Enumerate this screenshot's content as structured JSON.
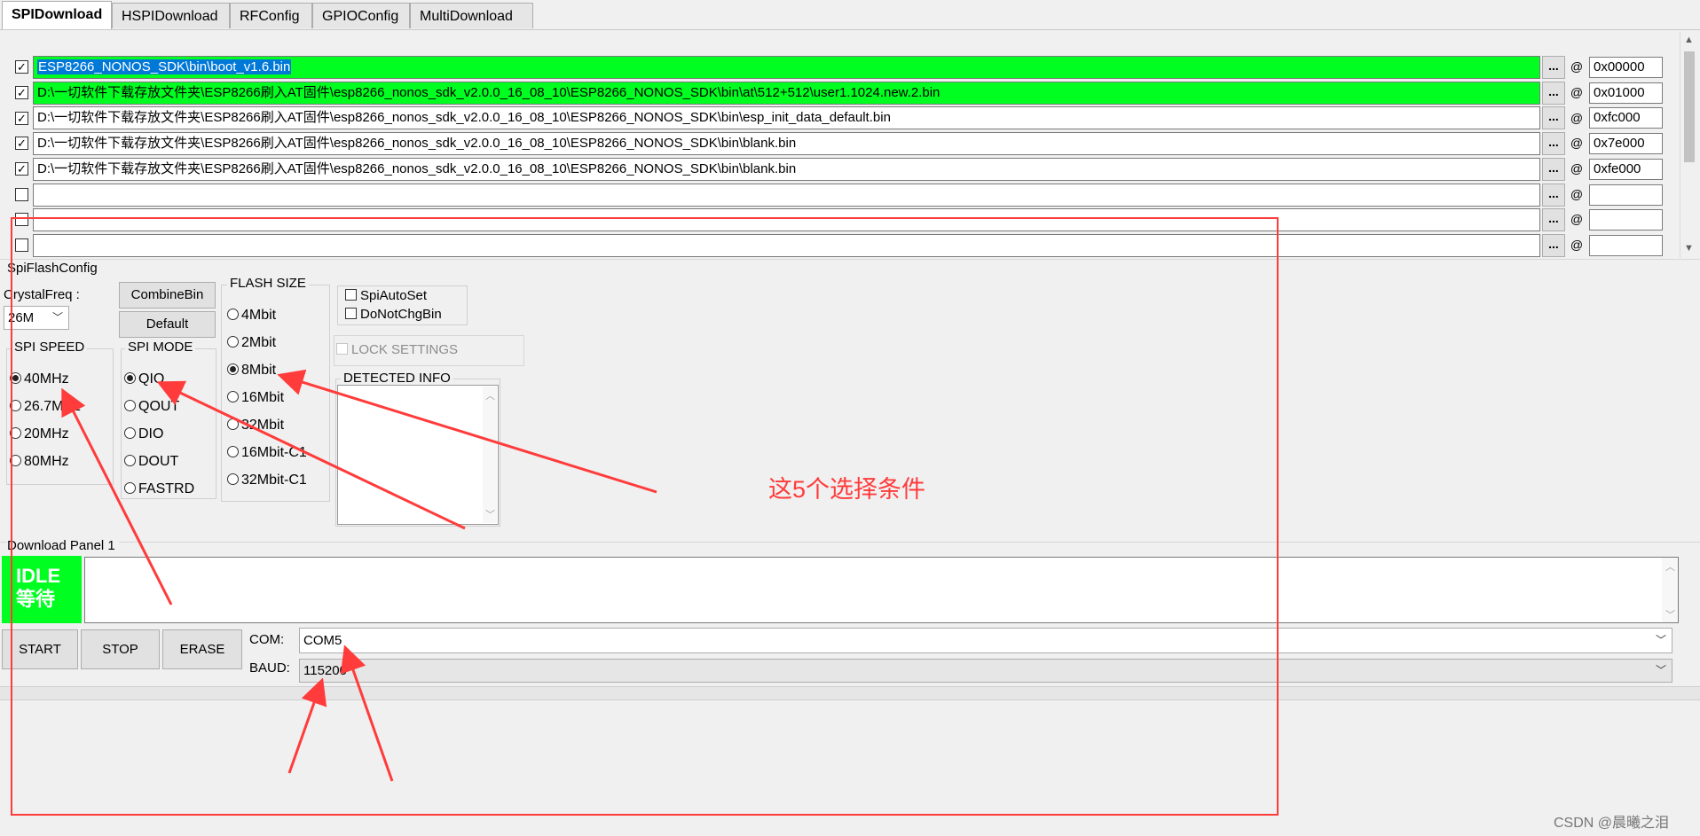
{
  "tabs": [
    "SPIDownload",
    "HSPIDownload",
    "RFConfig",
    "GPIOConfig",
    "MultiDownload"
  ],
  "files": [
    {
      "checked": true,
      "path": "ESP8266_NONOS_SDK\\bin\\boot_v1.6.bin",
      "address": "0x00000",
      "status_color": "#00ff21"
    },
    {
      "checked": true,
      "path": "D:\\一切软件下载存放文件夹\\ESP8266刷入AT固件\\esp8266_nonos_sdk_v2.0.0_16_08_10\\ESP8266_NONOS_SDK\\bin\\at\\512+512\\user1.1024.new.2.bin",
      "address": "0x01000",
      "status_color": "#00ff21"
    },
    {
      "checked": true,
      "path": "D:\\一切软件下载存放文件夹\\ESP8266刷入AT固件\\esp8266_nonos_sdk_v2.0.0_16_08_10\\ESP8266_NONOS_SDK\\bin\\esp_init_data_default.bin",
      "address": "0xfc000"
    },
    {
      "checked": true,
      "path": "D:\\一切软件下载存放文件夹\\ESP8266刷入AT固件\\esp8266_nonos_sdk_v2.0.0_16_08_10\\ESP8266_NONOS_SDK\\bin\\blank.bin",
      "address": "0x7e000"
    },
    {
      "checked": true,
      "path": "D:\\一切软件下载存放文件夹\\ESP8266刷入AT固件\\esp8266_nonos_sdk_v2.0.0_16_08_10\\ESP8266_NONOS_SDK\\bin\\blank.bin",
      "address": "0xfe000"
    },
    {
      "checked": false,
      "path": "",
      "address": ""
    },
    {
      "checked": false,
      "path": "",
      "address": ""
    },
    {
      "checked": false,
      "path": "",
      "address": ""
    }
  ],
  "browse_label": "...",
  "at_label": "@",
  "spi_flash_config": {
    "title": "SpiFlashConfig",
    "crystal_label": "CrystalFreq :",
    "crystal_value": "26M",
    "combine_button": "CombineBin",
    "default_button": "Default",
    "spi_speed": {
      "title": "SPI SPEED",
      "options": [
        "40MHz",
        "26.7MHz",
        "20MHz",
        "80MHz"
      ],
      "selected": "40MHz"
    },
    "spi_mode": {
      "title": "SPI MODE",
      "options": [
        "QIO",
        "QOUT",
        "DIO",
        "DOUT",
        "FASTRD"
      ],
      "selected": "QIO"
    },
    "flash_size": {
      "title": "FLASH SIZE",
      "options": [
        "4Mbit",
        "2Mbit",
        "8Mbit",
        "16Mbit",
        "32Mbit",
        "16Mbit-C1",
        "32Mbit-C1"
      ],
      "selected": "8Mbit"
    },
    "spi_auto_set": "SpiAutoSet",
    "do_not_chg_bin": "DoNotChgBin",
    "lock_settings": "LOCK SETTINGS",
    "detected_info": "DETECTED INFO"
  },
  "download_panel": {
    "title": "Download Panel 1",
    "status_en": "IDLE",
    "status_cn": "等待",
    "status_color": "#00ff21",
    "start_button": "START",
    "stop_button": "STOP",
    "erase_button": "ERASE",
    "com_label": "COM:",
    "com_value": "COM5",
    "baud_label": "BAUD:",
    "baud_value": "115200"
  },
  "annotation": {
    "text": "这5个选择条件",
    "color": "#ff3b3b"
  },
  "watermark": "CSDN @晨曦之泪"
}
